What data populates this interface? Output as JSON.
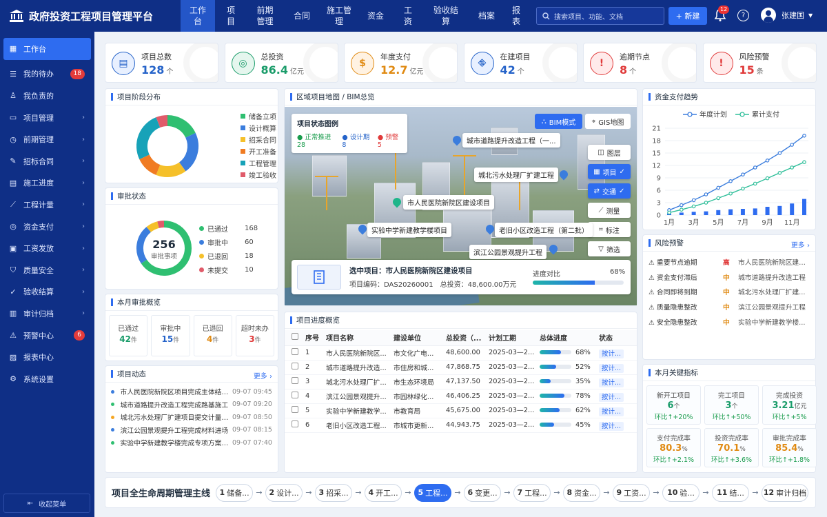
{
  "app": {
    "title": "政府投资工程项目管理平台"
  },
  "topnav": [
    "工作台",
    "项目",
    "前期管理",
    "合同",
    "施工管理",
    "资金",
    "工资",
    "验收结算",
    "档案",
    "报表"
  ],
  "search": {
    "placeholder": "搜索项目、功能、文档"
  },
  "new_button": "+ 新建",
  "notifications": "12",
  "user": {
    "name": "张建国"
  },
  "sidebar": {
    "items": [
      {
        "label": "工作台",
        "icon": "grid-icon"
      },
      {
        "label": "我的待办",
        "icon": "todo-icon",
        "badge": "18"
      },
      {
        "label": "我负责的",
        "icon": "person-icon"
      },
      {
        "label": "项目管理",
        "icon": "folder-icon",
        "arrow": true
      },
      {
        "label": "前期管理",
        "icon": "clock-icon",
        "arrow": true
      },
      {
        "label": "招标合同",
        "icon": "contract-icon",
        "arrow": true
      },
      {
        "label": "施工进度",
        "icon": "progress-icon",
        "arrow": true
      },
      {
        "label": "工程计量",
        "icon": "ruler-icon",
        "arrow": true
      },
      {
        "label": "资金支付",
        "icon": "money-icon",
        "arrow": true
      },
      {
        "label": "工资发放",
        "icon": "wallet-icon",
        "arrow": true
      },
      {
        "label": "质量安全",
        "icon": "shield-icon",
        "arrow": true
      },
      {
        "label": "验收结算",
        "icon": "check-icon",
        "arrow": true
      },
      {
        "label": "审计归档",
        "icon": "archive-icon",
        "arrow": true
      },
      {
        "label": "预警中心",
        "icon": "warning-icon",
        "badge": "6"
      },
      {
        "label": "报表中心",
        "icon": "report-icon"
      },
      {
        "label": "系统设置",
        "icon": "gear-icon"
      }
    ],
    "collapse": "收起菜单"
  },
  "stats": [
    {
      "label": "项目总数",
      "value": "128",
      "unit": "个",
      "color": "#2563c9"
    },
    {
      "label": "总投资",
      "value": "86.4",
      "unit": "亿元",
      "color": "#1a9c6a"
    },
    {
      "label": "年度支付",
      "value": "12.7",
      "unit": "亿元",
      "color": "#e08a12"
    },
    {
      "label": "在建项目",
      "value": "42",
      "unit": "个",
      "color": "#2563c9"
    },
    {
      "label": "逾期节点",
      "value": "8",
      "unit": "个",
      "color": "#e03a3a"
    },
    {
      "label": "风险预警",
      "value": "15",
      "unit": "条",
      "color": "#e03a3a"
    }
  ],
  "stage": {
    "title": "项目阶段分布",
    "legend": [
      {
        "label": "储备立项",
        "color": "#2fbf71"
      },
      {
        "label": "设计概算",
        "color": "#3b7ddd"
      },
      {
        "label": "招采合同",
        "color": "#f5c02a"
      },
      {
        "label": "开工准备",
        "color": "#f07b22"
      },
      {
        "label": "工程管理",
        "color": "#17a2b8"
      },
      {
        "label": "竣工验收",
        "color": "#e05b6a"
      }
    ],
    "values": [
      18,
      22,
      16,
      12,
      26,
      6
    ]
  },
  "approval": {
    "title": "审批状态",
    "total": "256",
    "total_label": "审批事项",
    "items": [
      {
        "label": "已通过",
        "value": "168",
        "color": "#2fbf71"
      },
      {
        "label": "审批中",
        "value": "60",
        "color": "#3b7ddd"
      },
      {
        "label": "已退回",
        "value": "18",
        "color": "#f5c02a"
      },
      {
        "label": "未提交",
        "value": "10",
        "color": "#e05b6a"
      }
    ]
  },
  "monthly": {
    "title": "本月审批概览",
    "items": [
      {
        "label": "已通过",
        "value": "42",
        "unit": "件",
        "color": "#1a9c6a"
      },
      {
        "label": "审批中",
        "value": "15",
        "unit": "件",
        "color": "#2563c9"
      },
      {
        "label": "已退回",
        "value": "4",
        "unit": "件",
        "color": "#e08a12"
      },
      {
        "label": "超时未办",
        "value": "3",
        "unit": "件",
        "color": "#e03a3a"
      }
    ]
  },
  "feed": {
    "title": "项目动态",
    "more": "更多 ›",
    "items": [
      {
        "text": "市人民医院新院区项目完成主体结构验收",
        "time": "09-07 09:45",
        "color": "#3b7ddd"
      },
      {
        "text": "城市道路提升改造工程完成路基施工",
        "time": "09-07 09:20",
        "color": "#2fbf71"
      },
      {
        "text": "城北污水处理厂扩建项目提交计量申请",
        "time": "09-07 08:50",
        "color": "#f5a623"
      },
      {
        "text": "滨江公园景观提升工程完成材料进场",
        "time": "09-07 08:15",
        "color": "#3b7ddd"
      },
      {
        "text": "实验中学新建教学楼完成专项方案评审",
        "time": "09-07 07:40",
        "color": "#2fbf71"
      }
    ]
  },
  "map": {
    "title": "区域项目地图 / BIM总览",
    "legend_title": "项目状态图例",
    "legend": [
      {
        "label": "正常推进",
        "value": "28",
        "color": "#1a9c4d"
      },
      {
        "label": "设计期",
        "value": "8",
        "color": "#2563c9"
      },
      {
        "label": "预警",
        "value": "5",
        "color": "#e03a3a"
      }
    ],
    "bim_button": "BIM模式",
    "gis_button": "GIS地图",
    "tools": [
      "图层",
      "项目",
      "交通",
      "测量",
      "标注",
      "筛选"
    ],
    "labels": [
      "城市道路提升改造工程（一...",
      "城北污水处理厂扩建工程",
      "市人民医院新院区建设项目",
      "实验中学新建教学楼项目",
      "老旧小区改造工程（第二批）",
      "滨江公园景观提升工程"
    ],
    "selected": {
      "title": "选中项目：市人民医院新院区建设项目",
      "code": "项目编码：DAS20260001",
      "invest": "总投资：48,600.00万元",
      "compare_label": "进度对比",
      "progress": 68,
      "progress_text": "68%"
    }
  },
  "progress_table": {
    "title": "项目进度概览",
    "headers": [
      "序号",
      "项目名称",
      "建设单位",
      "总投资（...",
      "计划工期",
      "总体进度",
      "状态"
    ],
    "rows": [
      {
        "no": "1",
        "name": "市人民医院新院区...",
        "unit": "市文化广电...",
        "invest": "48,600.00",
        "period": "2025-03—2...",
        "progress": 68,
        "ptext": "68%",
        "status": "按计..."
      },
      {
        "no": "2",
        "name": "城市道路提升改造...",
        "unit": "市住房和城...",
        "invest": "47,868.75",
        "period": "2025-03—2...",
        "progress": 52,
        "ptext": "52%",
        "status": "按计..."
      },
      {
        "no": "3",
        "name": "城北污水处理厂扩...",
        "unit": "市生态环境局",
        "invest": "47,137.50",
        "period": "2025-03—2...",
        "progress": 35,
        "ptext": "35%",
        "status": "按计..."
      },
      {
        "no": "4",
        "name": "滨江公园景观提升...",
        "unit": "市园林绿化...",
        "invest": "46,406.25",
        "period": "2025-03—2...",
        "progress": 78,
        "ptext": "78%",
        "status": "按计..."
      },
      {
        "no": "5",
        "name": "实验中学新建教学...",
        "unit": "市教育局",
        "invest": "45,675.00",
        "period": "2025-03—2...",
        "progress": 62,
        "ptext": "62%",
        "status": "按计..."
      },
      {
        "no": "6",
        "name": "老旧小区改造工程...",
        "unit": "市城市更新...",
        "invest": "44,943.75",
        "period": "2025-03—2...",
        "progress": 45,
        "ptext": "45%",
        "status": "按计..."
      }
    ]
  },
  "chart_data": {
    "type": "line",
    "title": "资金支付趋势",
    "categories": [
      "1月",
      "2月",
      "3月",
      "4月",
      "5月",
      "6月",
      "7月",
      "8月",
      "9月",
      "10月",
      "11月",
      "12月"
    ],
    "x_tick_labels": [
      "1月",
      "3月",
      "5月",
      "7月",
      "9月",
      "11月"
    ],
    "ylim": [
      0,
      21
    ],
    "yticks": [
      0,
      3,
      6,
      9,
      12,
      15,
      18,
      21
    ],
    "series": [
      {
        "name": "年度计划",
        "kind": "line",
        "color": "#3b7ddd",
        "values": [
          1.2,
          2.4,
          3.6,
          5.0,
          6.6,
          8.2,
          9.8,
          11.5,
          13.2,
          15.0,
          17.0,
          19.2
        ]
      },
      {
        "name": "累计支付",
        "kind": "line",
        "color": "#2fbf9a",
        "values": [
          0.6,
          1.3,
          2.1,
          3.0,
          4.1,
          5.2,
          6.4,
          7.6,
          8.9,
          10.2,
          11.5,
          12.8
        ]
      },
      {
        "name": "",
        "kind": "bar",
        "color": "#2e6cf0",
        "values": [
          0.4,
          0.6,
          0.8,
          0.9,
          1.2,
          1.4,
          1.5,
          1.6,
          2.0,
          2.2,
          2.8,
          3.9
        ]
      }
    ],
    "legend_position": "top"
  },
  "risk": {
    "title": "风险预警",
    "more": "更多 ›",
    "items": [
      {
        "name": "重要节点逾期",
        "level": "高",
        "level_color": "#e03a3a",
        "project": "市人民医院新院区建设..."
      },
      {
        "name": "资金支付滞后",
        "level": "中",
        "level_color": "#e08a12",
        "project": "城市道路提升改造工程"
      },
      {
        "name": "合同即将到期",
        "level": "中",
        "level_color": "#e08a12",
        "project": "城北污水处理厂扩建..."
      },
      {
        "name": "质量隐患整改",
        "level": "中",
        "level_color": "#e08a12",
        "project": "滨江公园景观提升工程"
      },
      {
        "name": "安全隐患整改",
        "level": "中",
        "level_color": "#e08a12",
        "project": "实验中学新建教学楼..."
      }
    ]
  },
  "kpi": {
    "title": "本月关键指标",
    "items": [
      {
        "label": "新开工项目",
        "value": "6",
        "unit": "个",
        "change": "环比↑+20%",
        "color": "#1a9c6a"
      },
      {
        "label": "完工项目",
        "value": "3",
        "unit": "个",
        "change": "环比↑+50%",
        "color": "#1a9c6a"
      },
      {
        "label": "完成投资",
        "value": "3.21",
        "unit": "亿元",
        "change": "环比↑+5%",
        "color": "#1a9c6a"
      },
      {
        "label": "支付完成率",
        "value": "80.3",
        "unit": "%",
        "change": "环比↑+2.1%",
        "color": "#e08a12"
      },
      {
        "label": "投资完成率",
        "value": "70.1",
        "unit": "%",
        "change": "环比↑+3.6%",
        "color": "#e08a12"
      },
      {
        "label": "审批完成率",
        "value": "85.4",
        "unit": "%",
        "change": "环比↑+1.8%",
        "color": "#e08a12"
      }
    ]
  },
  "lifecycle": {
    "title": "项目全生命周期管理主线",
    "steps": [
      {
        "no": "1",
        "label": "储备..."
      },
      {
        "no": "2",
        "label": "设计..."
      },
      {
        "no": "3",
        "label": "招采..."
      },
      {
        "no": "4",
        "label": "开工..."
      },
      {
        "no": "5",
        "label": "工程...",
        "active": true
      },
      {
        "no": "6",
        "label": "变更..."
      },
      {
        "no": "7",
        "label": "工程..."
      },
      {
        "no": "8",
        "label": "资金..."
      },
      {
        "no": "9",
        "label": "工资..."
      },
      {
        "no": "10",
        "label": "验..."
      },
      {
        "no": "11",
        "label": "结..."
      },
      {
        "no": "12",
        "label": "审计归档"
      }
    ]
  }
}
